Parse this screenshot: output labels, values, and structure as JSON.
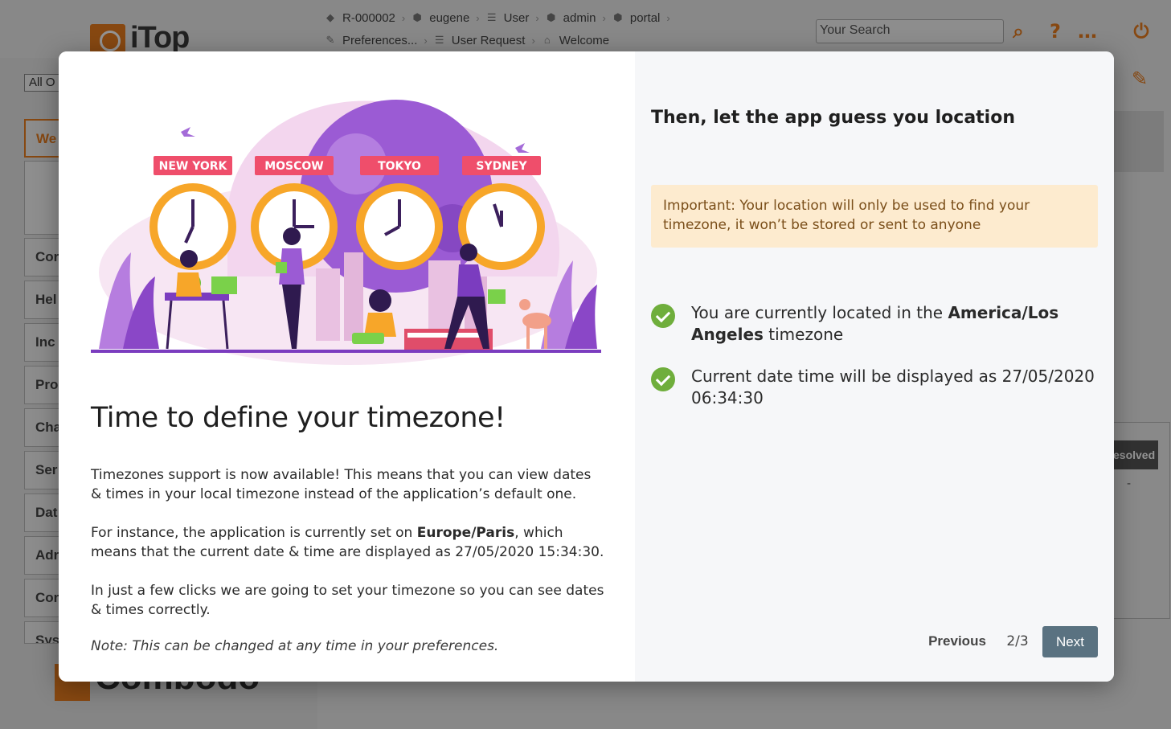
{
  "app": {
    "logo_text": "iTop",
    "footer_logo_text": "Combodo",
    "breadcrumbs_row1": [
      {
        "label": "R-000002",
        "icon": "ticket-icon"
      },
      {
        "label": "eugene",
        "icon": "user-cube-icon"
      },
      {
        "label": "User",
        "icon": "list-icon"
      },
      {
        "label": "admin",
        "icon": "user-cube-icon"
      },
      {
        "label": "portal",
        "icon": "user-cube-icon"
      }
    ],
    "breadcrumbs_row2": [
      {
        "label": "Preferences...",
        "icon": "wrench-icon"
      },
      {
        "label": "User Request",
        "icon": "list-icon"
      },
      {
        "label": "Welcome",
        "icon": "home-icon"
      }
    ],
    "search_placeholder": "Your Search",
    "org_select_value": "All O",
    "sidebar_items": [
      "We",
      "Cor",
      "Hel",
      "Inc",
      "Pro",
      "Cha",
      "Ser",
      "Dat",
      "Adr",
      "Cor",
      "Sys"
    ],
    "resolved_badge": "esolved",
    "dash": "-",
    "accent_color": "#e87c1e"
  },
  "modal": {
    "illustration": {
      "cities": [
        "NEW YORK",
        "MOSCOW",
        "TOKYO",
        "SYDNEY"
      ]
    },
    "title": "Time to define your timezone!",
    "para1": "Timezones support is now available! This means that you can view dates & times in your local timezone instead of the application’s default one.",
    "para2_prefix": "For instance, the application is currently set on ",
    "para2_bold": "Europe/Paris",
    "para2_suffix": ", which means that the current date & time are displayed as 27/05/2020 15:34:30.",
    "para3": "In just a few clicks we are going to set your timezone so you can see dates & times correctly.",
    "note": "Note: This can be changed at any time in your preferences.",
    "right_title": "Then, let the app guess you location",
    "alert_text": "Important: Your location will only be used to find your timezone, it won’t be stored or sent to anyone",
    "check1_prefix": "You are currently located in the ",
    "check1_bold": "America/Los Angeles",
    "check1_suffix": " timezone",
    "check2": "Current date time will be displayed as 27/05/2020 06:34:30",
    "previous_label": "Previous",
    "page_indicator": "2/3",
    "next_label": "Next",
    "next_color": "#5a7281",
    "alert_color": "#fdebcf",
    "check_color": "#6fae3c"
  }
}
